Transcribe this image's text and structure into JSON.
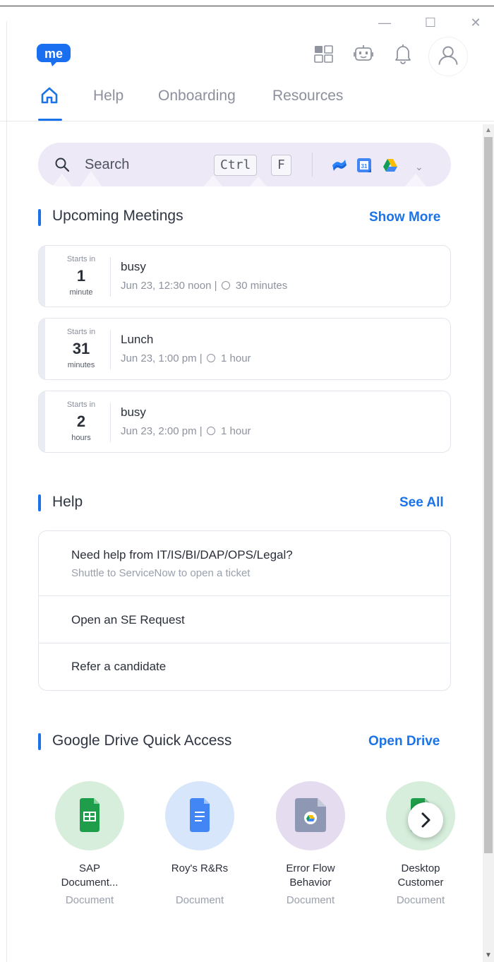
{
  "window_controls": {
    "minimize": "—",
    "maximize": "☐",
    "close": "✕"
  },
  "app": {
    "logo_text": "me"
  },
  "header": {
    "icons": [
      "apps-icon",
      "chatbot-icon",
      "bell-icon",
      "user-icon"
    ]
  },
  "tabs": [
    {
      "icon": "home-icon",
      "active": true
    },
    {
      "label": "Help"
    },
    {
      "label": "Onboarding"
    },
    {
      "label": "Resources"
    }
  ],
  "search": {
    "placeholder": "Search",
    "shortcut_ctrl": "Ctrl",
    "shortcut_key": "F",
    "sources": [
      "confluence-icon",
      "google-calendar-icon",
      "google-drive-icon"
    ],
    "calendar_day": "31"
  },
  "meetings": {
    "title": "Upcoming Meetings",
    "link": "Show More",
    "items": [
      {
        "starts_label": "Starts in",
        "number": "1",
        "unit": "minute",
        "title": "busy",
        "when": "Jun 23, 12:30 noon",
        "duration": "30 minutes"
      },
      {
        "starts_label": "Starts in",
        "number": "31",
        "unit": "minutes",
        "title": "Lunch",
        "when": "Jun 23, 1:00 pm",
        "duration": "1 hour"
      },
      {
        "starts_label": "Starts in",
        "number": "2",
        "unit": "hours",
        "title": "busy",
        "when": "Jun 23, 2:00 pm",
        "duration": "1 hour"
      }
    ],
    "separator": "|"
  },
  "help": {
    "title": "Help",
    "link": "See All",
    "items": [
      {
        "title": "Need help from IT/IS/BI/DAP/OPS/Legal?",
        "subtitle": "Shuttle to ServiceNow to open a ticket"
      },
      {
        "title": "Open an SE Request"
      },
      {
        "title": "Refer a candidate"
      }
    ]
  },
  "drive": {
    "title": "Google Drive Quick Access",
    "link": "Open Drive",
    "items": [
      {
        "name_line1": "SAP",
        "name_line2": "Document...",
        "type": "Document",
        "icon": "google-sheets-icon"
      },
      {
        "name_line1": "Roy's R&Rs",
        "name_line2": "",
        "type": "Document",
        "icon": "google-docs-icon"
      },
      {
        "name_line1": "Error Flow",
        "name_line2": "Behavior",
        "type": "Document",
        "icon": "drive-file-icon"
      },
      {
        "name_line1": "Desktop",
        "name_line2": "Customer",
        "type": "Document",
        "icon": "google-sheets-icon"
      }
    ]
  },
  "colors": {
    "accent": "#1a73e8",
    "search_bg": "#eee9f7",
    "sheets_green": "#1e9e4a",
    "docs_blue": "#4285f4"
  }
}
